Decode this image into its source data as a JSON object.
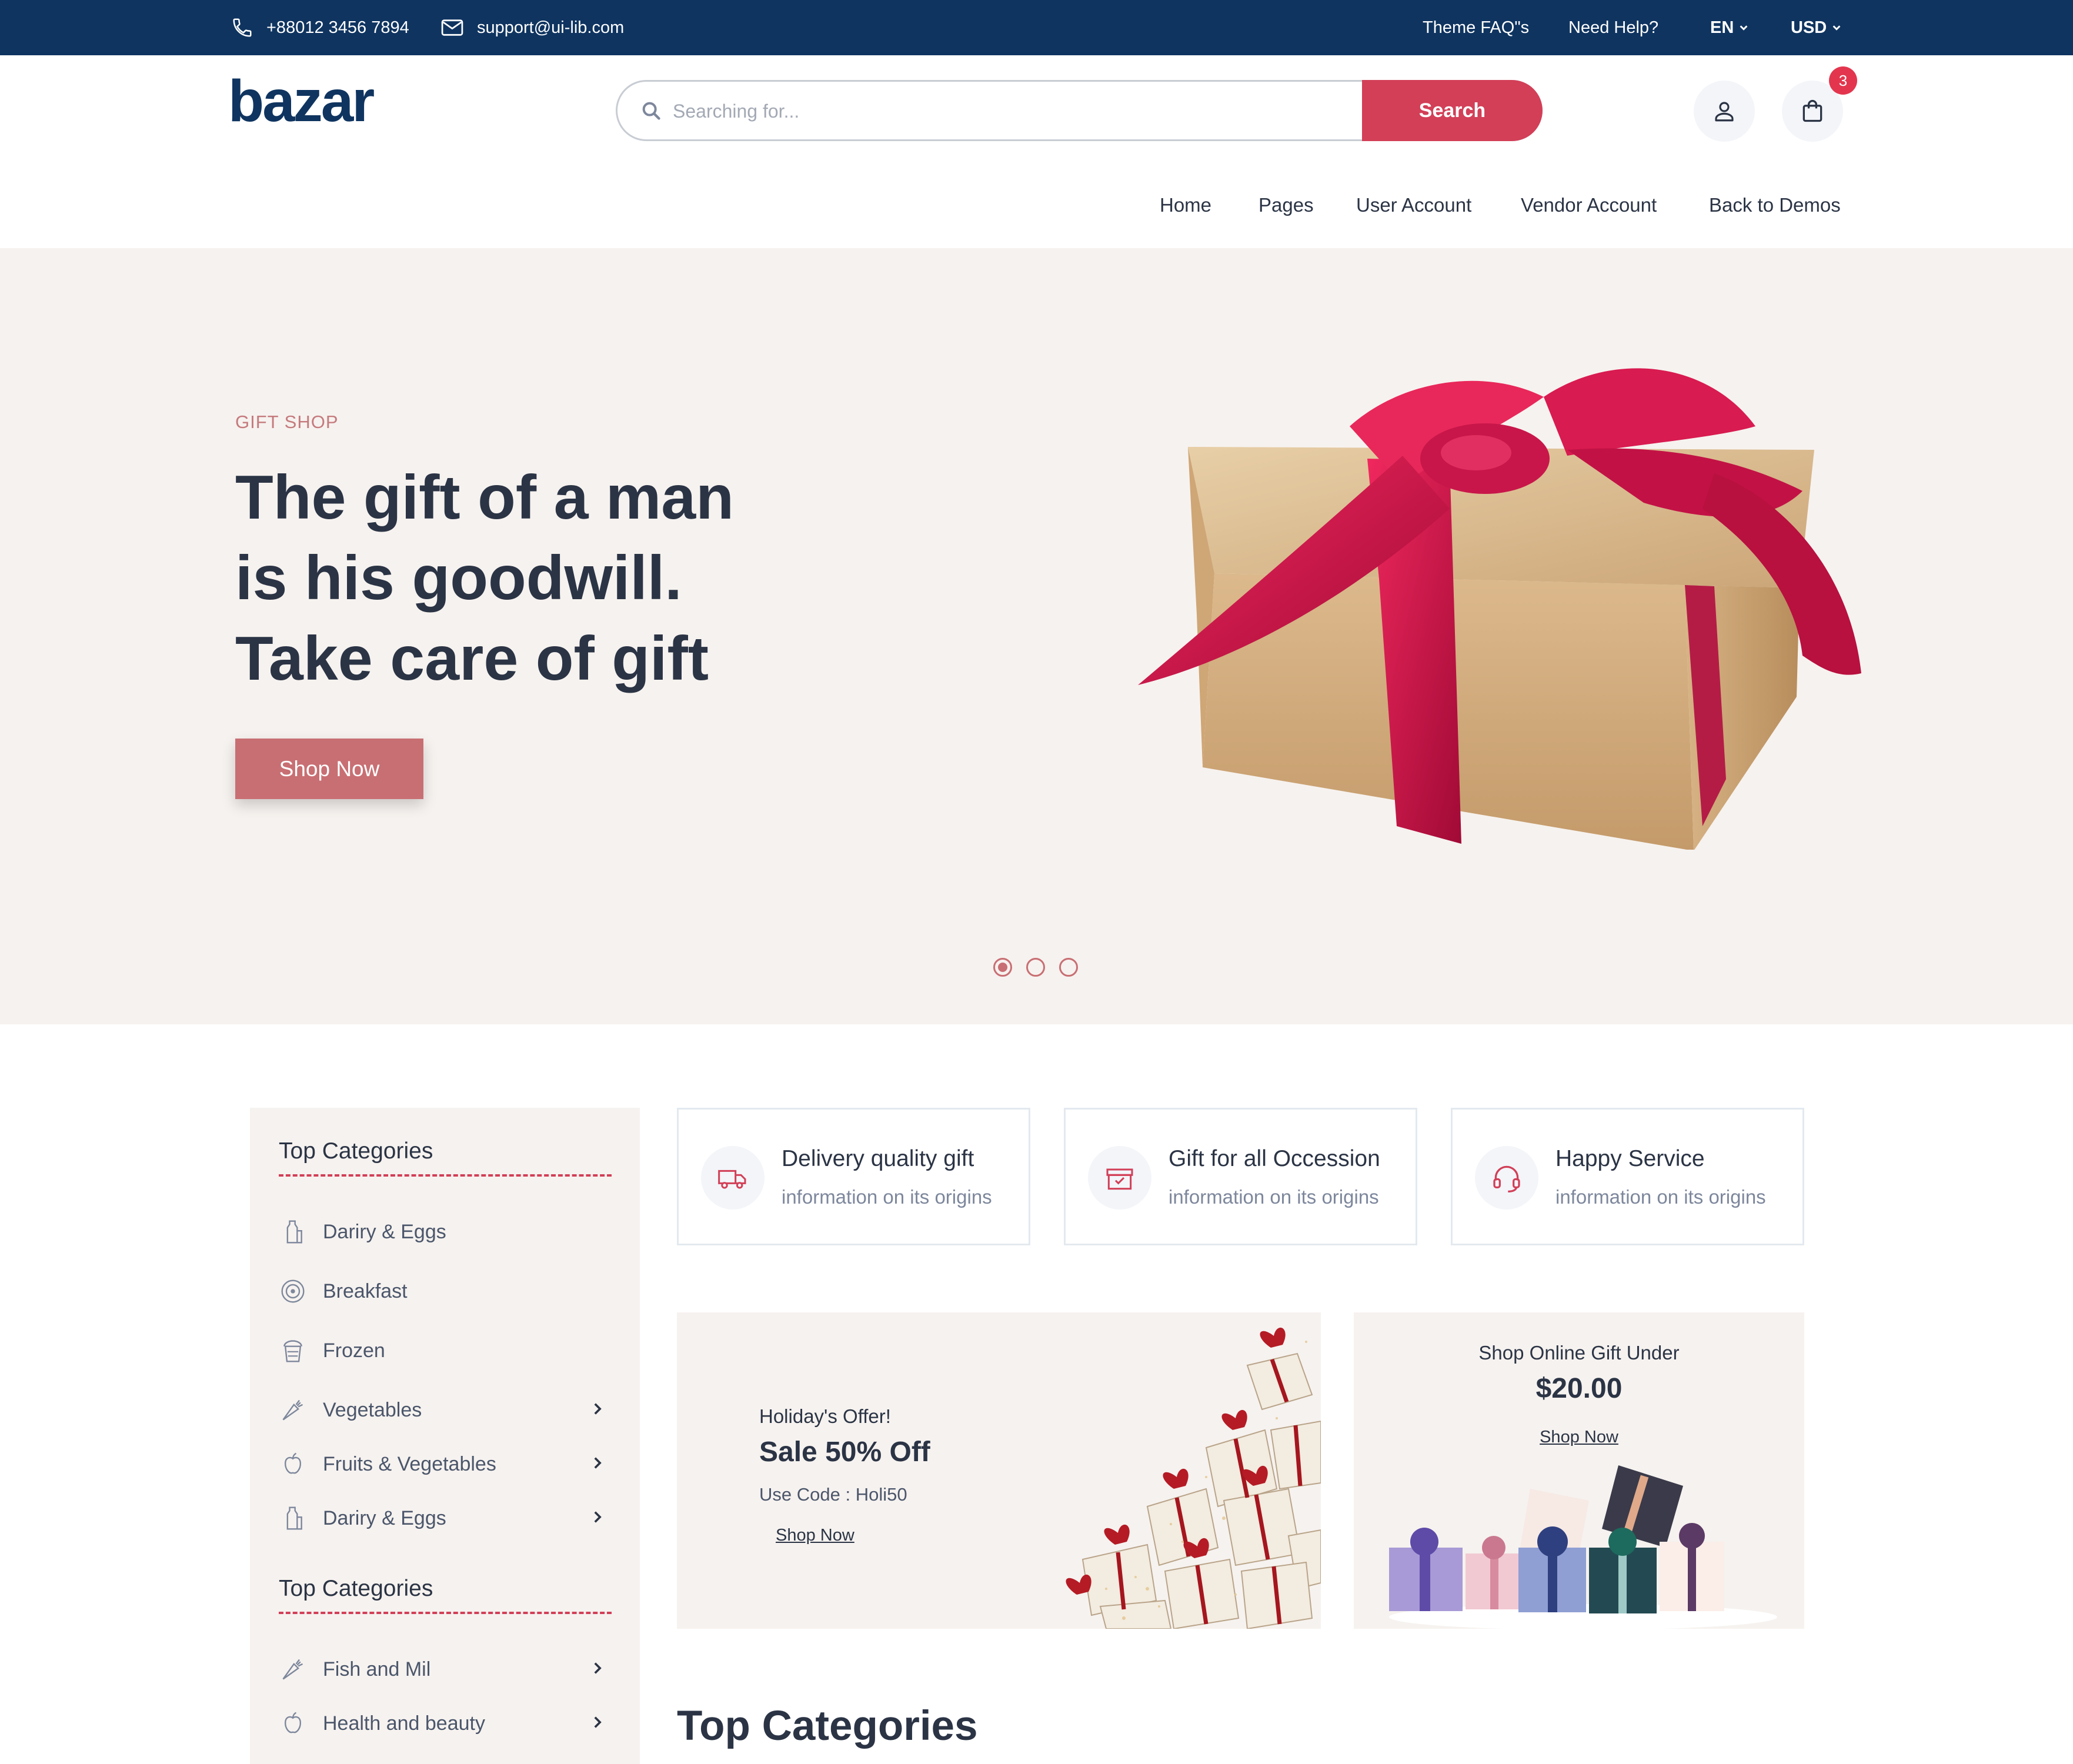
{
  "topbar": {
    "phone": "+88012 3456 7894",
    "email": "support@ui-lib.com",
    "links": [
      "Theme FAQ\"s",
      "Need Help?"
    ],
    "language": "EN",
    "currency": "USD"
  },
  "header": {
    "logo_text": "bazar",
    "search_placeholder": "Searching for...",
    "search_button": "Search",
    "cart_count": "3",
    "nav": [
      "Home",
      "Pages",
      "User Account",
      "Vendor Account",
      "Back to Demos"
    ]
  },
  "hero": {
    "tag": "GIFT SHOP",
    "title_lines": [
      "The gift of a man",
      "is his goodwill.",
      "Take care of gift"
    ],
    "button": "Shop Now",
    "slides": 3,
    "active_slide": 1
  },
  "sidebar": {
    "sections": [
      {
        "title": "Top Categories",
        "items": [
          {
            "label": "Dariry & Eggs",
            "icon": "milk-bottle-icon",
            "has_submenu": false
          },
          {
            "label": "Breakfast",
            "icon": "breakfast-plate-icon",
            "has_submenu": false
          },
          {
            "label": "Frozen",
            "icon": "frozen-cup-icon",
            "has_submenu": false
          },
          {
            "label": "Vegetables",
            "icon": "carrot-icon",
            "has_submenu": true
          },
          {
            "label": "Fruits & Vegetables",
            "icon": "apple-icon",
            "has_submenu": true
          },
          {
            "label": "Dariry & Eggs",
            "icon": "milk-bottle-icon",
            "has_submenu": true
          }
        ]
      },
      {
        "title": "Top Categories",
        "items": [
          {
            "label": "Fish and Mil",
            "icon": "carrot-icon",
            "has_submenu": true
          },
          {
            "label": "Health and beauty",
            "icon": "apple-icon",
            "has_submenu": true
          }
        ]
      }
    ]
  },
  "services": [
    {
      "title": "Delivery quality gift",
      "subtitle": "information on its origins",
      "icon": "delivery-truck-icon"
    },
    {
      "title": "Gift for all Occession",
      "subtitle": "information on its origins",
      "icon": "gift-box-icon"
    },
    {
      "title": "Happy Service",
      "subtitle": "information on its origins",
      "icon": "headset-icon"
    }
  ],
  "promo_holiday": {
    "kicker": "Holiday's Offer!",
    "headline": "Sale 50% Off",
    "code": "Use Code : Holi50",
    "link": "Shop Now"
  },
  "promo_under": {
    "kicker": "Shop Online Gift Under",
    "price": "$20.00",
    "link": "Shop Now"
  },
  "section_title": "Top Categories",
  "colors": {
    "topbar": "#0f3460",
    "primary": "#d23f57",
    "hero_bg": "#f6f2ef",
    "hero_button": "#c86f73",
    "text": "#2b3445"
  }
}
